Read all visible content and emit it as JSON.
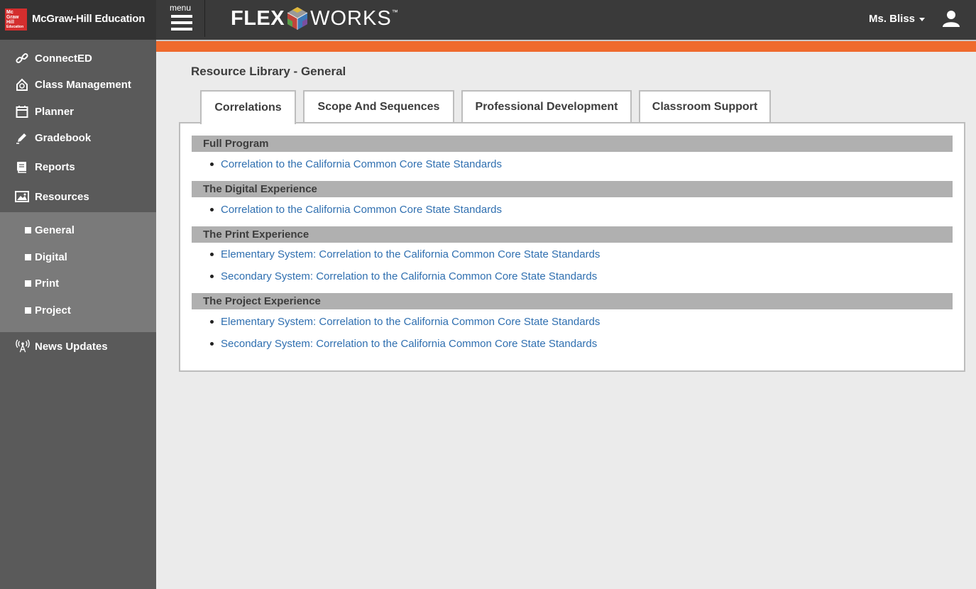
{
  "header": {
    "brand_logo_lines": [
      "Mc",
      "Graw",
      "Hill",
      "Education"
    ],
    "brand_name": "McGraw-Hill Education",
    "menu_label": "menu",
    "product_flex": "FLEX",
    "product_works": "WORKS",
    "product_tm": "™",
    "user_name": "Ms. Bliss"
  },
  "sidebar": {
    "items": [
      {
        "label": "ConnectED",
        "icon": "link-icon"
      },
      {
        "label": "Class Management",
        "icon": "school-icon"
      },
      {
        "label": "Planner",
        "icon": "calendar-icon"
      },
      {
        "label": "Gradebook",
        "icon": "pencil-icon"
      },
      {
        "label": "Reports",
        "icon": "book-icon"
      },
      {
        "label": "Resources",
        "icon": "image-icon"
      }
    ],
    "sub_items": [
      "General",
      "Digital",
      "Print",
      "Project"
    ],
    "news": {
      "label": "News Updates",
      "icon": "antenna-icon"
    }
  },
  "main": {
    "title": "Resource Library - General",
    "tabs": [
      "Correlations",
      "Scope And Sequences",
      "Professional Development",
      "Classroom Support"
    ],
    "active_tab": "Correlations",
    "sections": [
      {
        "heading": "Full Program",
        "links": [
          "Correlation to the California Common Core State Standards"
        ]
      },
      {
        "heading": "The Digital Experience",
        "links": [
          "Correlation to the California Common Core State Standards"
        ]
      },
      {
        "heading": "The Print Experience",
        "links": [
          "Elementary System: Correlation to the California Common Core State Standards",
          "Secondary System: Correlation to the California Common Core State Standards"
        ]
      },
      {
        "heading": "The Project Experience",
        "links": [
          "Elementary System: Correlation to the California Common Core State Standards",
          "Secondary System: Correlation to the California Common Core State Standards"
        ]
      }
    ]
  },
  "colors": {
    "topbar": "#3a3a3a",
    "accent_orange": "#ef6a2d",
    "sidebar": "#5a5a5a",
    "subnav": "#7a7a7a",
    "link": "#2f6fb0",
    "section_head": "#b0b0b0"
  }
}
